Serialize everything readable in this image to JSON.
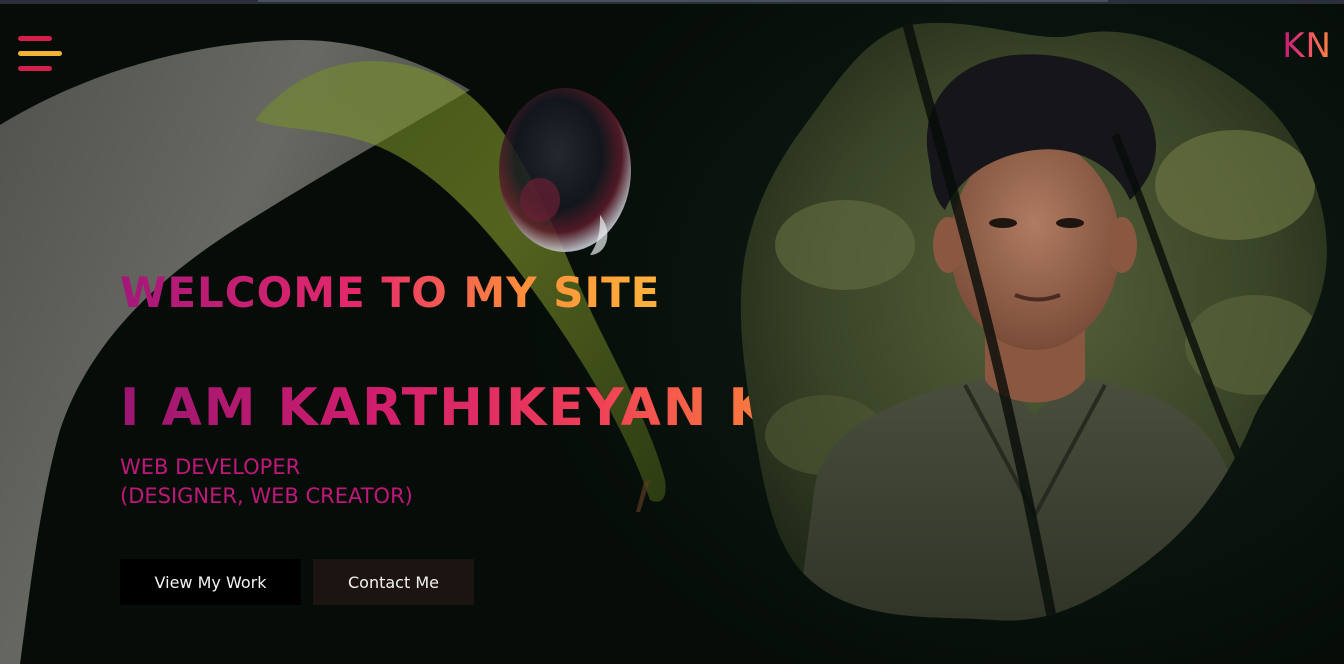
{
  "header": {
    "menu_icon": "hamburger-menu-icon",
    "logo_text": "KN"
  },
  "hero": {
    "welcome": "WELCOME TO MY SITE",
    "name": "I AM KARTHIKEYAN K M",
    "role_line1": "WEB DEVELOPER",
    "role_line2": "(DESIGNER, WEB CREATOR)"
  },
  "buttons": {
    "view_work": "View My Work",
    "contact": "Contact Me"
  },
  "colors": {
    "gradient_start": "#a3177a",
    "gradient_mid": "#e8286a",
    "gradient_end": "#ffb23c",
    "menu_red": "#d41f4c",
    "menu_yellow": "#f2b233",
    "background": "#060d09"
  }
}
